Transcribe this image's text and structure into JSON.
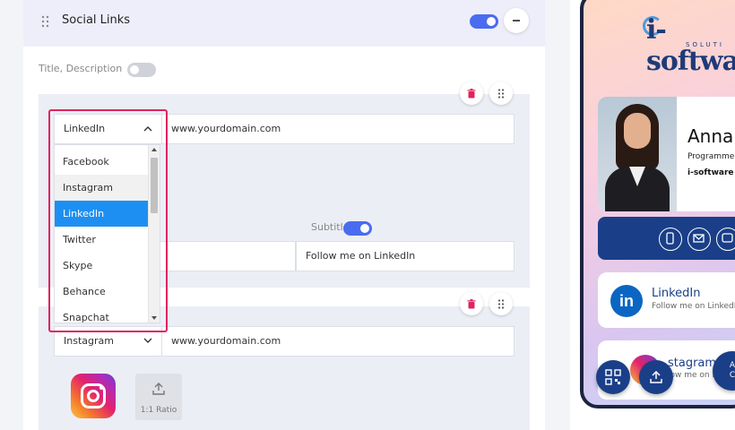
{
  "section": {
    "title": "Social Links",
    "enabled": true
  },
  "title_description": {
    "label": "Title, Description",
    "enabled": false
  },
  "link1": {
    "platform": "LinkedIn",
    "url": "www.yourdomain.com",
    "subtitle_label": "Subtitle",
    "subtitle_enabled": true,
    "subtitle_value": "Follow me on LinkedIn"
  },
  "dropdown": {
    "options": [
      "Facebook",
      "Instagram",
      "LinkedIn",
      "Twitter",
      "Skype",
      "Behance",
      "Snapchat"
    ],
    "selected": "LinkedIn",
    "hovered": "Instagram"
  },
  "link2": {
    "platform": "Instagram",
    "url": "www.yourdomain.com",
    "upload_ratio": "1:1 Ratio"
  },
  "preview": {
    "logo_main": "i-softwa",
    "logo_sub": "SOLUTI",
    "name": "Anna",
    "role": "Programme",
    "company": "i-software S",
    "links": [
      {
        "title": "LinkedIn",
        "subtitle": "Follow me on LinkedI"
      },
      {
        "title": "stagram",
        "subtitle": "low me on In"
      }
    ],
    "fab_partial": "A\nC"
  },
  "colors": {
    "accent": "#4a6cf0",
    "selected": "#1e8ff2",
    "highlight": "#e0245e",
    "delete": "#e0245e",
    "brand": "#1a3f88"
  }
}
